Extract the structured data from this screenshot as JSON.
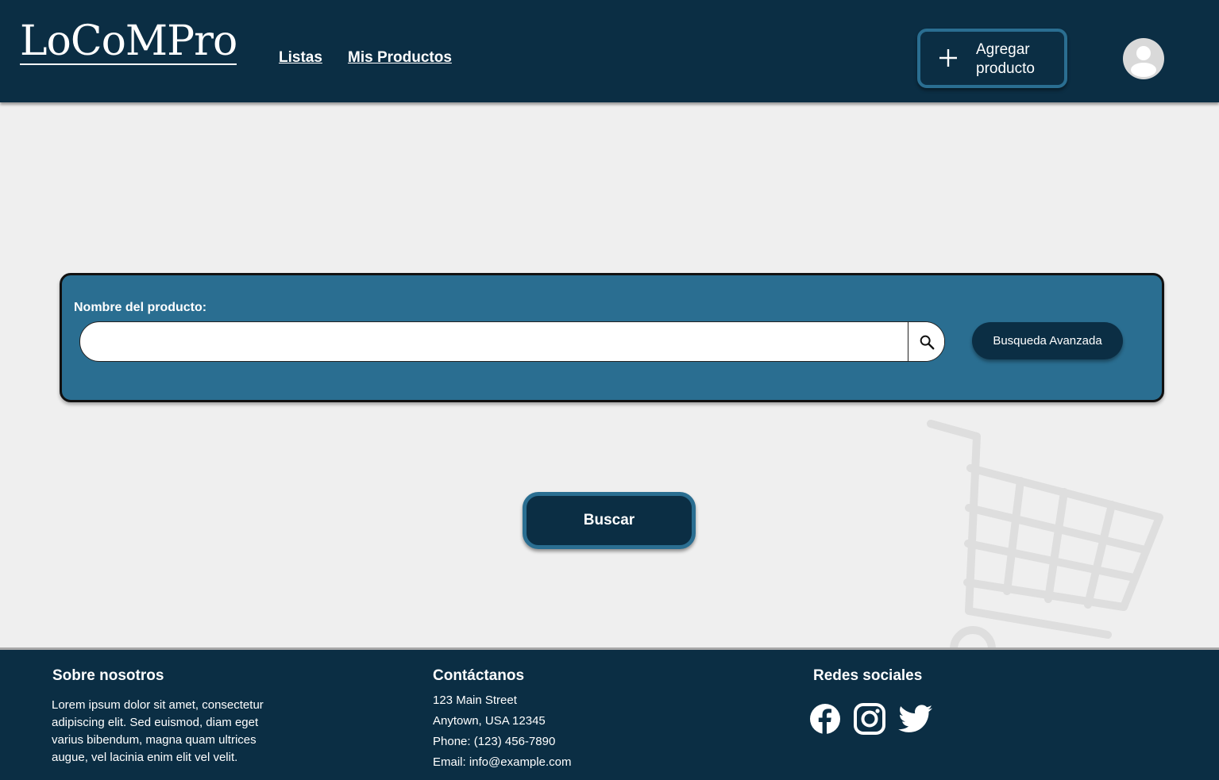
{
  "header": {
    "logo": "LoCoMPro",
    "nav": {
      "listas": "Listas",
      "mis_productos": "Mis Productos"
    },
    "add_product_label": "Agregar producto",
    "colors": {
      "background": "#0b2e44",
      "accent": "#2a6e91"
    }
  },
  "search": {
    "label": "Nombre del producto:",
    "input_value": "",
    "advanced_label": "Busqueda Avanzada",
    "icon": "search-icon",
    "panel_color": "#2a6e91"
  },
  "buscar_label": "Buscar",
  "footer": {
    "about": {
      "title": "Sobre nosotros",
      "text": "Lorem ipsum dolor sit amet, consectetur adipiscing elit. Sed euismod, diam eget varius bibendum, magna quam ultrices augue, vel lacinia enim elit vel velit."
    },
    "contact": {
      "title": "Contáctanos",
      "lines": [
        "123 Main Street",
        "Anytown, USA 12345",
        "Phone: (123) 456-7890",
        "Email: info@example.com"
      ]
    },
    "social": {
      "title": "Redes sociales",
      "icons": [
        "facebook-icon",
        "instagram-icon",
        "twitter-icon"
      ]
    }
  },
  "decor": {
    "background_icon": "shopping-cart-icon"
  }
}
